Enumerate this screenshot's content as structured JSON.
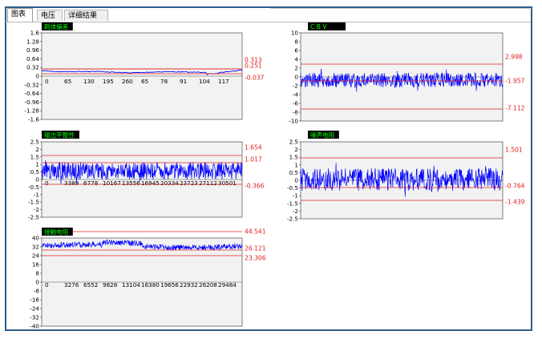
{
  "tabs": [
    {
      "label": "图表",
      "active": true
    },
    {
      "label": "电压",
      "active": false
    },
    {
      "label": "详细结果",
      "active": false
    }
  ],
  "colors": {
    "signal": "#0000ff",
    "limit": "#e02020",
    "plot_bg": "#f2f2f2",
    "title_bg": "#000000",
    "title_fg": "#00ff00",
    "frame": "#2f5c8a"
  },
  "charts": [
    {
      "key": "c0",
      "title": "刷体偏差",
      "yticks": [
        "1.6",
        "1.28",
        "0.96",
        "0.64",
        "0.32",
        "0",
        "-0.32",
        "-0.64",
        "-0.96",
        "-1.28",
        "-1.6"
      ],
      "xticks": [
        "0",
        "65",
        "130",
        "195",
        "260",
        "65",
        "78",
        "91",
        "104",
        "117"
      ],
      "limits": [
        "0.313",
        "0.251",
        "-0.037"
      ]
    },
    {
      "key": "c1",
      "title": "C B V",
      "yticks": [
        "10",
        "8",
        "6",
        "4",
        "2",
        "0",
        "-2",
        "-4",
        "-6",
        "-8",
        "-10"
      ],
      "xticks": [],
      "limits": [
        "2.998",
        "-1.957",
        "-7.112"
      ]
    },
    {
      "key": "c2",
      "title": "输出平整性",
      "yticks": [
        "2.5",
        "2",
        "1.5",
        "1",
        "0.5",
        "0",
        "-0.5",
        "-1",
        "-1.5",
        "-2",
        "-2.5"
      ],
      "xticks": [
        "0",
        "3389",
        "6778",
        "10167",
        "13556",
        "16945",
        "20334",
        "23723",
        "27112",
        "30501"
      ],
      "limits": [
        "1.654",
        "1.017",
        "-0.366"
      ]
    },
    {
      "key": "c3",
      "title": "噪声电阻",
      "yticks": [
        "2.5",
        "2",
        "1.5",
        "1",
        "0.5",
        "0",
        "-0.5",
        "-1",
        "-1.5",
        "-2",
        "-2.5"
      ],
      "xticks": [],
      "limits": [
        "1.501",
        "-0.764",
        "-1.439"
      ]
    },
    {
      "key": "c4",
      "title": "接触电阻",
      "yticks": [
        "40",
        "32",
        "24",
        "16",
        "8",
        "0",
        "-8",
        "-16",
        "-24",
        "-32",
        "-40"
      ],
      "xticks": [
        "0",
        "3276",
        "6552",
        "9828",
        "13104",
        "16380",
        "19656",
        "22932",
        "26208",
        "29484"
      ],
      "limits": [
        "44.541",
        "26.121",
        "23.306"
      ]
    }
  ]
}
